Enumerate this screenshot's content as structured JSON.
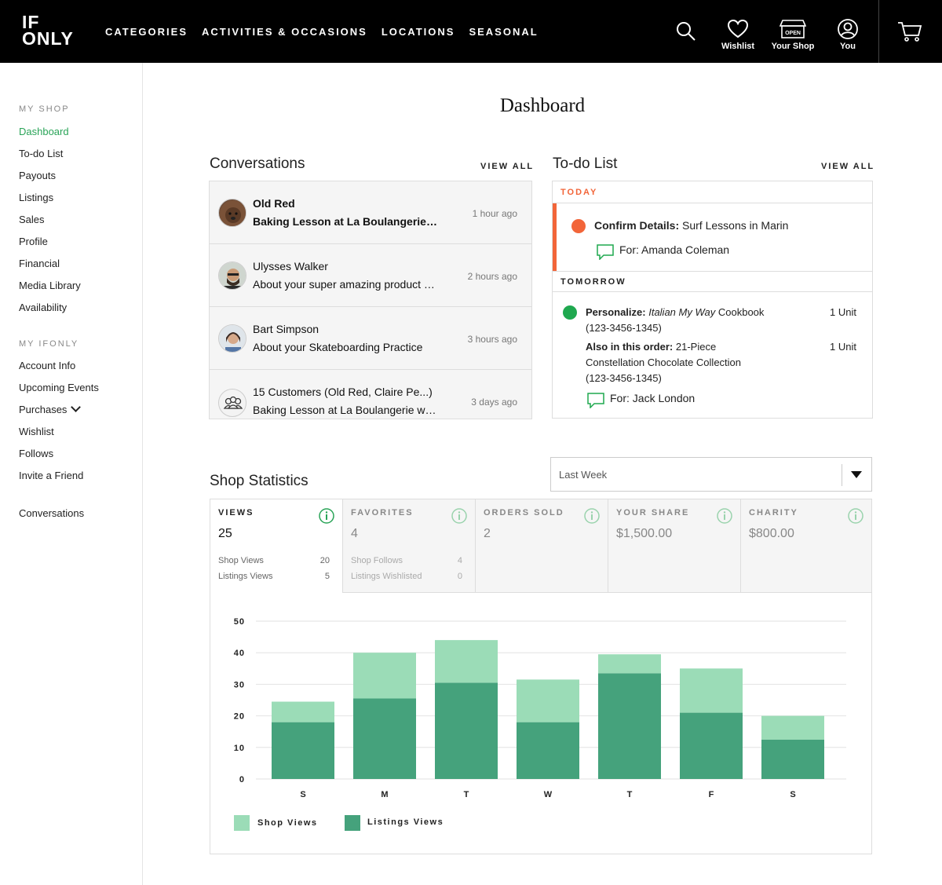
{
  "header": {
    "logo_top": "IF",
    "logo_bottom": "ONLY",
    "nav": [
      "CATEGORIES",
      "ACTIVITIES & OCCASIONS",
      "LOCATIONS",
      "SEASONAL"
    ],
    "wishlist": "Wishlist",
    "your_shop": "Your Shop",
    "shop_sign": "OPEN",
    "you": "You"
  },
  "sidebar": {
    "my_shop_heading": "MY SHOP",
    "my_shop": [
      "Dashboard",
      "To-do List",
      "Payouts",
      "Listings",
      "Sales",
      "Profile",
      "Financial",
      "Media Library",
      "Availability"
    ],
    "my_ifonly_heading": "MY IFONLY",
    "my_ifonly": [
      "Account Info",
      "Upcoming Events",
      "Purchases",
      "Wishlist",
      "Follows",
      "Invite a Friend"
    ],
    "conversations": "Conversations"
  },
  "page": {
    "title": "Dashboard"
  },
  "conversations": {
    "title": "Conversations",
    "view_all": "VIEW ALL",
    "items": [
      {
        "name": "Old Red",
        "subject": "Baking Lesson at La Boulangerie with Chef Frank",
        "time": "1 hour ago",
        "unread": true
      },
      {
        "name": "Ulysses Walker",
        "subject": "About your super amazing product listing",
        "time": "2 hours ago",
        "unread": false
      },
      {
        "name": "Bart Simpson",
        "subject": "About your Skateboarding Practice",
        "time": "3 hours ago",
        "unread": false
      },
      {
        "name": "15 Customers (Old Red, Claire Pe...)",
        "subject": "Baking Lesson at La Boulangerie with Chef Frank",
        "time": "3 days ago",
        "unread": false
      }
    ]
  },
  "todo": {
    "title": "To-do List",
    "view_all": "VIEW ALL",
    "today_label": "TODAY",
    "tomorrow_label": "TOMORROW",
    "today_item": {
      "action": "Confirm Details:",
      "text": "Surf Lessons in Marin",
      "for": "For: Amanda Coleman"
    },
    "tomorrow_item": {
      "action": "Personalize:",
      "italic": "Italian My Way",
      "text": "Cookbook",
      "order": "(123-3456-1345)",
      "units": "1 Unit",
      "also_label": "Also in this order:",
      "also_text_1": "21-Piece",
      "also_text_2": "Constellation Chocolate Collection",
      "also_order": "(123-3456-1345)",
      "also_units": "1 Unit",
      "for": "For: Jack London"
    },
    "colors": {
      "today": "#f26539",
      "tomorrow": "#1fa84f"
    }
  },
  "stats": {
    "title": "Shop Statistics",
    "range": "Last Week",
    "tabs": [
      {
        "name": "VIEWS",
        "value": "25",
        "sub": [
          {
            "label": "Shop Views",
            "value": "20"
          },
          {
            "label": "Listings Views",
            "value": "5"
          }
        ]
      },
      {
        "name": "FAVORITES",
        "value": "4",
        "sub": [
          {
            "label": "Shop Follows",
            "value": "4"
          },
          {
            "label": "Listings Wishlisted",
            "value": "0"
          }
        ]
      },
      {
        "name": "ORDERS SOLD",
        "value": "2",
        "sub": []
      },
      {
        "name": "YOUR SHARE",
        "value": "$1,500.00",
        "sub": []
      },
      {
        "name": "CHARITY",
        "value": "$800.00",
        "sub": []
      }
    ]
  },
  "chart_data": {
    "type": "bar",
    "stacked": true,
    "categories": [
      "S",
      "M",
      "T",
      "W",
      "T",
      "F",
      "S"
    ],
    "series": [
      {
        "name": "Listings Views",
        "values": [
          18,
          25.5,
          30.5,
          18,
          33.5,
          21,
          12.5
        ],
        "color": "#45a27c"
      },
      {
        "name": "Shop Views",
        "values": [
          6.5,
          14.5,
          13.5,
          13.5,
          6,
          14,
          7.5
        ],
        "color": "#9bdcb7"
      }
    ],
    "ylim": [
      0,
      50
    ],
    "yticks": [
      0,
      10,
      20,
      30,
      40,
      50
    ],
    "legend": [
      {
        "name": "Shop Views",
        "color": "#9bdcb7"
      },
      {
        "name": "Listings Views",
        "color": "#45a27c"
      }
    ],
    "legend_position": "bottom-left",
    "grid": true
  }
}
